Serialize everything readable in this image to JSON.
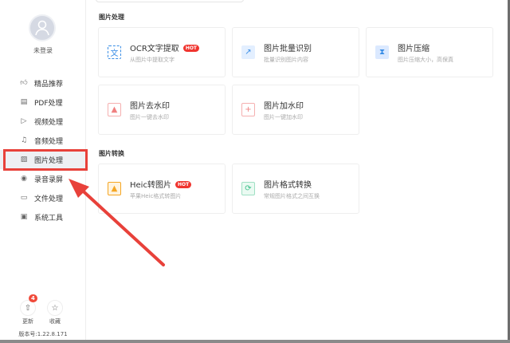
{
  "user": {
    "login_status": "未登录"
  },
  "nav": [
    {
      "label": "精品推荐",
      "icon": "thumbs-up-icon"
    },
    {
      "label": "PDF处理",
      "icon": "pdf-icon"
    },
    {
      "label": "视频处理",
      "icon": "video-icon"
    },
    {
      "label": "音频处理",
      "icon": "music-icon"
    },
    {
      "label": "图片处理",
      "icon": "image-icon",
      "active": true
    },
    {
      "label": "录音录屏",
      "icon": "record-icon"
    },
    {
      "label": "文件处理",
      "icon": "folder-icon"
    },
    {
      "label": "系统工具",
      "icon": "monitor-icon"
    }
  ],
  "footer": {
    "update_label": "更新",
    "update_badge": "4",
    "favorite_label": "收藏",
    "version": "版本号:1.22.8.171"
  },
  "sections": [
    {
      "title": "图片处理",
      "cards": [
        {
          "title": "OCR文字提取",
          "hot": "HOT",
          "desc": "从图片中提取文字",
          "color": "#3a8ee6"
        },
        {
          "title": "图片批量识别",
          "desc": "批量识别图片内容",
          "color": "#3a8ee6"
        },
        {
          "title": "图片压缩",
          "desc": "图片压缩大小，高保真",
          "color": "#3a8ee6"
        },
        {
          "title": "图片去水印",
          "desc": "图片一键去水印",
          "color": "#f08080"
        },
        {
          "title": "图片加水印",
          "desc": "图片一键加水印",
          "color": "#f08080"
        }
      ]
    },
    {
      "title": "图片转换",
      "cards": [
        {
          "title": "Heic转图片",
          "hot": "HOT",
          "desc": "苹果Heic格式转图片",
          "color": "#f5a623"
        },
        {
          "title": "图片格式转换",
          "desc": "常规图片格式之间互换",
          "color": "#3cc08a"
        }
      ]
    }
  ]
}
